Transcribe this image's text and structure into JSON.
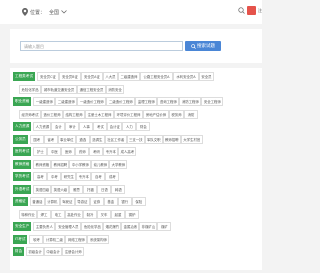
{
  "header": {
    "location_label": "位置：",
    "location_value": "全国",
    "right_text": "注"
  },
  "search": {
    "placeholder": "请输入题目",
    "button_label": "搜索试题"
  },
  "colors": {
    "accent_green": "#3aa653",
    "button_blue": "#4a86d6"
  },
  "categories": [
    {
      "head": "工程类考试",
      "items": [
        "安全员C证",
        "安全员B证",
        "安全员A证",
        "八大员",
        "二级建造师",
        "公路工程安全员A",
        "水利安全员A",
        "安全员"
      ]
    },
    {
      "head": "",
      "items": [
        "危险化学品",
        "城市轨道交通安全员",
        "通信工程安全员",
        "消防安全"
      ]
    },
    {
      "head": "职业资格",
      "items": [
        "一级建造师",
        "二级建造师",
        "一级造价工程师",
        "二级造价工程师",
        "监理工程师",
        "咨询工程师",
        "消防工程师",
        "安全工程师"
      ]
    },
    {
      "head": "",
      "items": [
        "经济师考试",
        "造价工程师",
        "结构工程师",
        "注册土木工程师",
        "环境评价工程师",
        "房地产估价师",
        "税务师",
        "消防"
      ]
    },
    {
      "head": "人力资源",
      "items": [
        "人力资源",
        "会计",
        "审计",
        "人事",
        "考试",
        "会计证",
        "人力",
        "财会"
      ]
    },
    {
      "head": "公务员",
      "items": [
        "国考",
        "省考",
        "事业单位",
        "遴选",
        "选调生",
        "社区工作者",
        "三支一扶",
        "军队文职",
        "教师招聘",
        "大学生村官"
      ]
    },
    {
      "head": "医药考试",
      "items": [
        "护士",
        "中医",
        "医师",
        "药师",
        "考研",
        "专升本",
        "成人高考"
      ]
    },
    {
      "head": "教师资格",
      "items": [
        "教师资格",
        "教师招聘",
        "中小学教师",
        "幼儿教师",
        "大学教师"
      ]
    },
    {
      "head": "学历考试",
      "items": [
        "高考",
        "中考",
        "研究生",
        "专升本",
        "自考",
        "成考"
      ]
    },
    {
      "head": "外语考试",
      "items": [
        "英语四级",
        "英语六级",
        "雅思",
        "托福",
        "日语",
        "韩语"
      ]
    },
    {
      "head": "资格证",
      "items": [
        "普通话",
        "计算机",
        "驾驶证",
        "导游证",
        "证券",
        "基金",
        "银行",
        "保险"
      ]
    },
    {
      "head": "",
      "items": [
        "特种作业",
        "焊工",
        "电工",
        "高处作业",
        "制冷",
        "叉车",
        "起重",
        "锅炉"
      ]
    },
    {
      "head": "安全生产",
      "items": [
        "主要负责人",
        "安全管理人员",
        "危险化学品",
        "烟花爆竹",
        "金属冶炼",
        "非煤矿山",
        "煤矿"
      ]
    },
    {
      "head": "IT考试",
      "items": [
        "软考",
        "计算机二级",
        "网络工程师",
        "系统架构师"
      ]
    },
    {
      "head": "财会",
      "items": [
        "初级会计",
        "中级会计",
        "注册会计师"
      ]
    }
  ]
}
